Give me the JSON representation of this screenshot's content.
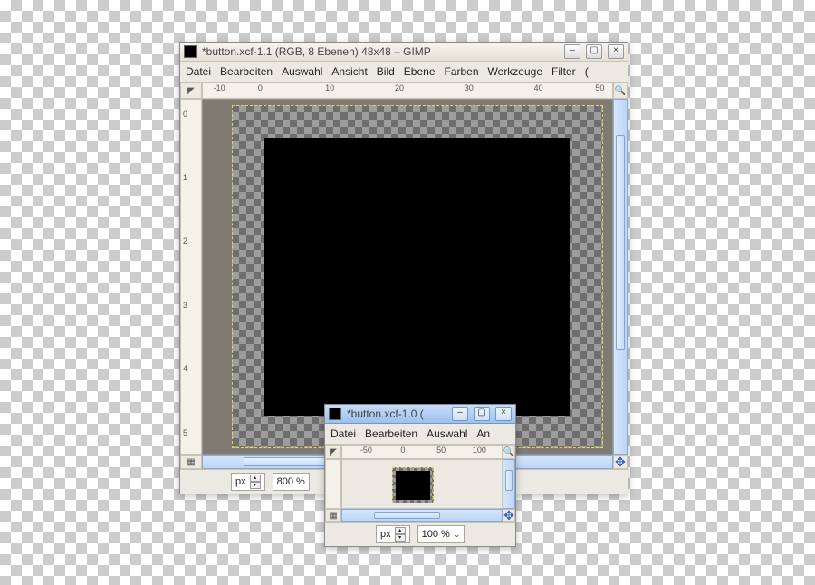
{
  "main_window": {
    "title": "*button.xcf-1.1 (RGB, 8 Ebenen) 48x48 – GIMP",
    "menu": {
      "file": "Datei",
      "edit": "Bearbeiten",
      "select": "Auswahl",
      "view": "Ansicht",
      "image": "Bild",
      "layer": "Ebene",
      "colors": "Farben",
      "tools": "Werkzeuge",
      "filters": "Filter",
      "overflow": "("
    },
    "ruler_h": {
      "m10": "-10",
      "p0": "0",
      "p10": "10",
      "p20": "20",
      "p30": "30",
      "p40": "40",
      "p50": "50"
    },
    "ruler_v": {
      "p0": "0",
      "p1": "1",
      "p2": "2",
      "p3": "3",
      "p4": "4",
      "p5": "5"
    },
    "quickmask_icon": "▦",
    "nav_icon": "✥",
    "unit": "px",
    "zoom": "800 %"
  },
  "small_window": {
    "title": "*button.xcf-1.0 (",
    "menu": {
      "file": "Datei",
      "edit": "Bearbeiten",
      "select": "Auswahl",
      "overflow": "An"
    },
    "ruler_h": {
      "m50": "-50",
      "p0": "0",
      "p50": "50",
      "p100": "100"
    },
    "unit": "px",
    "zoom": "100 %",
    "nav_icon": "✥",
    "quickmask_icon": "▦"
  }
}
